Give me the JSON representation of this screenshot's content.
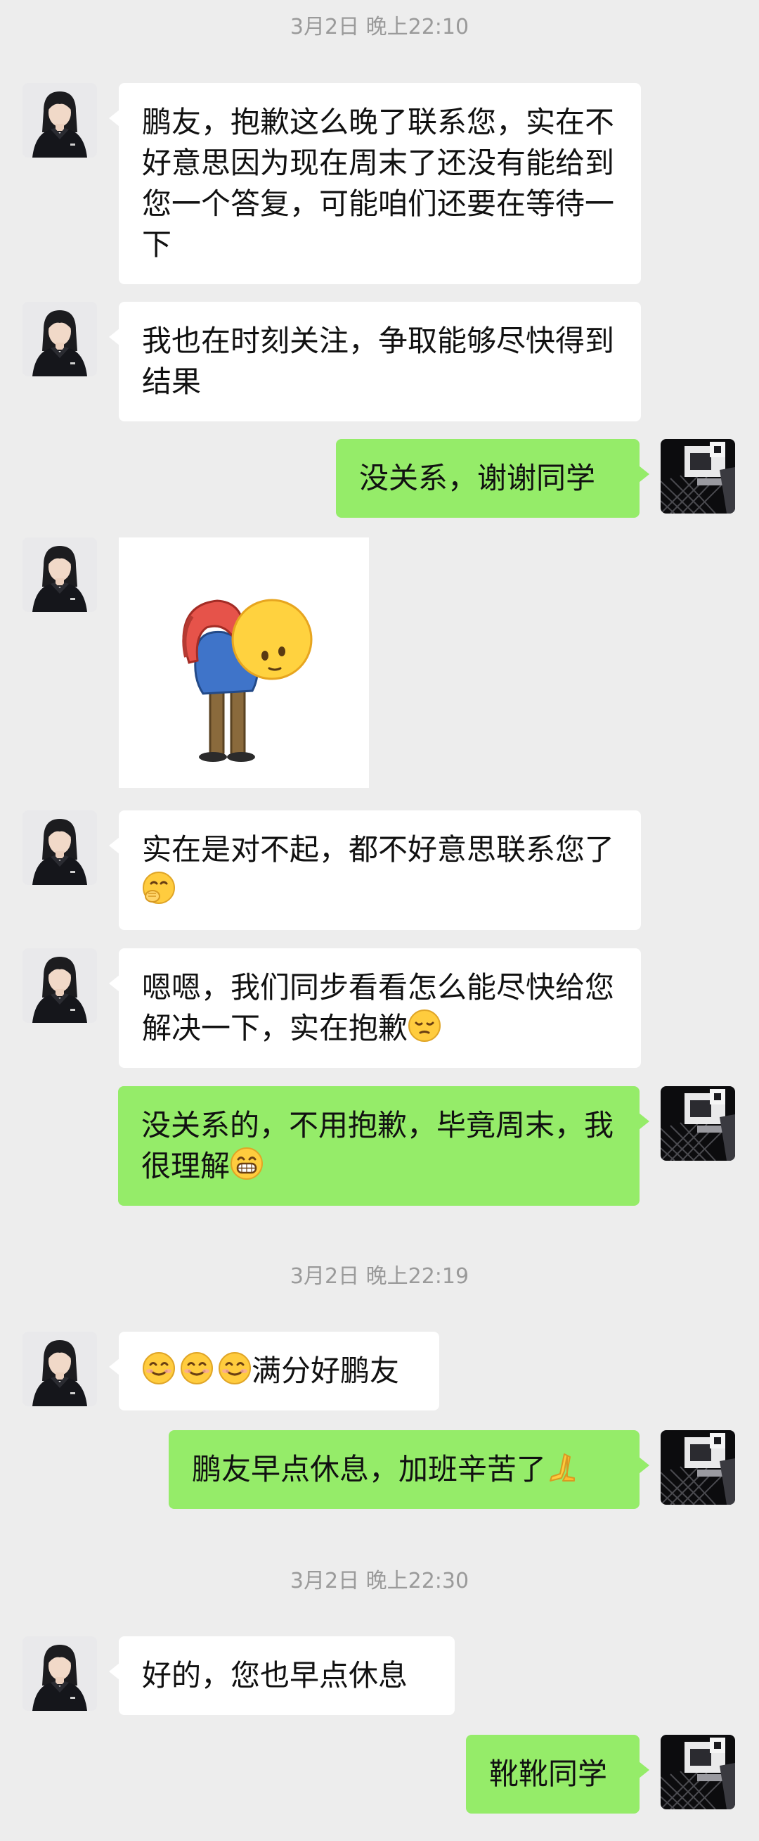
{
  "timestamps": [
    "3月2日 晚上22:10",
    "3月2日 晚上22:19",
    "3月2日 晚上22:30"
  ],
  "messages": {
    "m1": "鹏友，抱歉这么晚了联系您，实在不好意思因为现在周末了还没有能给到您一个答复，可能咱们还要在等待一下",
    "m2": "我也在时刻关注，争取能够尽快得到结果",
    "m3": "没关系，谢谢同学",
    "m5": "实在是对不起，都不好意思联系您了",
    "m6": "嗯嗯，我们同步看看怎么能尽快给您解决一下，实在抱歉",
    "m7": "没关系的，不用抱歉，毕竟周末，我很理解",
    "m8": "满分好鹏友",
    "m9": "鹏友早点休息，加班辛苦了",
    "m10": "好的，您也早点休息",
    "m11": "靴靴同学"
  },
  "emoji": {
    "m5": "hand-over-mouth-emoji",
    "m6": "pensive-face-emoji",
    "m7": "grinning-face-emoji",
    "m8": [
      "smiling-face-emoji",
      "smiling-face-emoji",
      "smiling-face-emoji"
    ],
    "m9": "folded-hands-emoji"
  },
  "sticker": {
    "name": "bowing-emoji-sticker"
  },
  "colors": {
    "background": "#ededed",
    "incoming_bubble": "#ffffff",
    "outgoing_bubble": "#95ec69",
    "timestamp_text": "#9a9a9a"
  }
}
